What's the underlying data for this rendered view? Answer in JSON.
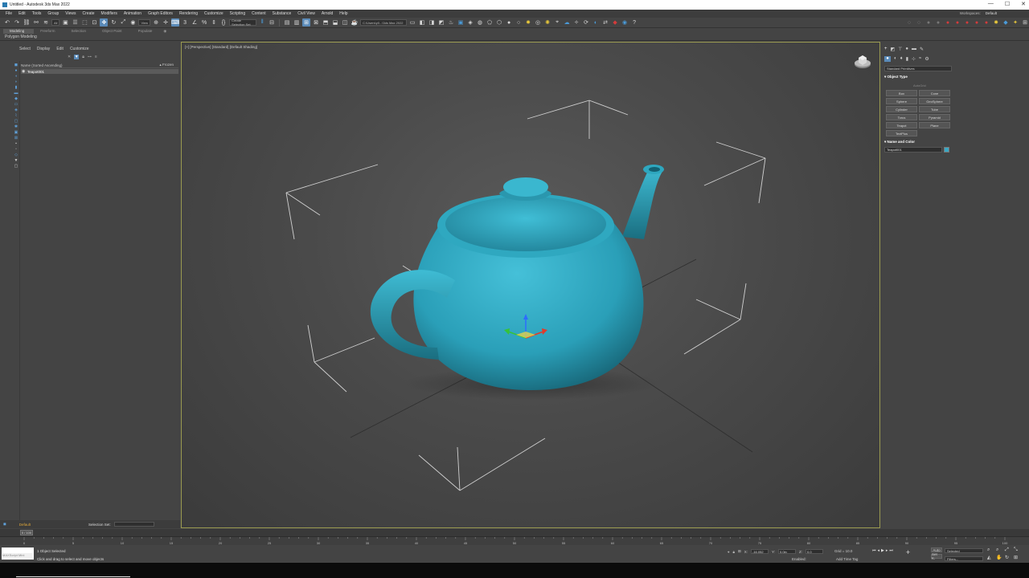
{
  "window": {
    "title": "Untitled - Autodesk 3ds Max 2022",
    "controls": [
      "—",
      "☐",
      "✕"
    ]
  },
  "menu": {
    "items": [
      "File",
      "Edit",
      "Tools",
      "Group",
      "Views",
      "Create",
      "Modifiers",
      "Animation",
      "Graph Editors",
      "Rendering",
      "Customize",
      "Scripting",
      "Content",
      "Substance",
      "Civil View",
      "Arnold",
      "Help"
    ],
    "workspaces_label": "Workspaces:",
    "workspaces_value": "Default"
  },
  "toolbar": {
    "all_filter": "All",
    "view_dropdown": "View",
    "create_selection_set": "Create Selection Set",
    "project_path": "C:\\Users\\y0...\\3ds Max 2022"
  },
  "ribbon": {
    "tabs": [
      "Modeling",
      "Freeform",
      "Selection",
      "Object Paint",
      "Populate"
    ],
    "active_tab": "Modeling",
    "panel_label": "Polygon Modeling"
  },
  "scene_explorer": {
    "tabs": [
      "Select",
      "Display",
      "Edit",
      "Customize"
    ],
    "column_header": "Name (Sorted Ascending)",
    "frozen_header": "▴ Frozen",
    "object_name": "Teapot001"
  },
  "layer_bar": {
    "layer_name": "Default",
    "selection_set_label": "Selection Set:"
  },
  "viewport": {
    "label": "[+] [Perspective] [Standard] [Default Shading]"
  },
  "command_panel": {
    "dropdown": "Standard Primitives",
    "object_type_header": "▾ Object Type",
    "autogrid": "AutoGrid",
    "buttons": [
      "Box",
      "Cone",
      "Sphere",
      "GeoSphere",
      "Cylinder",
      "Tube",
      "Torus",
      "Pyramid",
      "Teapot",
      "Plane",
      "TextPlus"
    ],
    "name_color_header": "▾ Name and Color",
    "object_name": "Teapot001",
    "object_color": "#3aa8c4"
  },
  "timeline": {
    "frame_display": "0 / 100",
    "tick_labels": [
      "0",
      "5",
      "10",
      "15",
      "20",
      "25",
      "30",
      "35",
      "40",
      "45",
      "50",
      "55",
      "60",
      "65",
      "70",
      "75",
      "80",
      "85",
      "90",
      "95",
      "100"
    ]
  },
  "status": {
    "maxscript_label": "MAXScript Mini",
    "objects_selected": "1 Object Selected",
    "prompt": "Click and drag to select and move objects",
    "x_label": "X:",
    "x_value": "-16.052",
    "y_label": "Y:",
    "y_value": "0.0in",
    "z_label": "Z:",
    "z_value": "0.0",
    "grid": "Grid = 10.0",
    "enabled": "Enabled:",
    "add_time_tag": "Add Time Tag",
    "auto_key": "Auto",
    "set_key": "Set K.",
    "selected_dropdown": "Selected",
    "filters": "Filters..."
  },
  "colors": {
    "teapot": "#2fa3bb",
    "viewport_border": "#9a9a50",
    "accent": "#5a8ab8"
  }
}
